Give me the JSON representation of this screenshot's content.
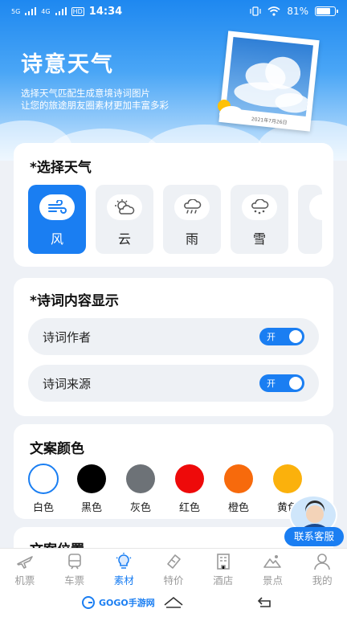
{
  "status_bar": {
    "signal_left": "5G",
    "signal_right": "4G",
    "network": "HD",
    "time": "14:34",
    "battery": "81%",
    "battery_level": 0.81
  },
  "hero": {
    "title": "诗意天气",
    "subtitle_line1": "选择天气匹配生成意境诗词图片",
    "subtitle_line2": "让您的旅途朋友圈素材更加丰富多彩",
    "photo_date": "2021年7月26日"
  },
  "weather_section": {
    "title": "*选择天气",
    "items": [
      {
        "label": "风",
        "icon": "wind-icon",
        "active": true
      },
      {
        "label": "云",
        "icon": "partly-cloudy-icon",
        "active": false
      },
      {
        "label": "雨",
        "icon": "rain-icon",
        "active": false
      },
      {
        "label": "雪",
        "icon": "snow-icon",
        "active": false
      }
    ]
  },
  "poem_section": {
    "title": "*诗词内容显示",
    "rows": [
      {
        "label": "诗词作者",
        "toggle": "开",
        "on": true
      },
      {
        "label": "诗词来源",
        "toggle": "开",
        "on": true
      }
    ]
  },
  "color_section": {
    "title": "文案颜色",
    "swatches": [
      {
        "label": "白色",
        "color": "#ffffff",
        "selected": true
      },
      {
        "label": "黑色",
        "color": "#000000",
        "selected": false
      },
      {
        "label": "灰色",
        "color": "#6d7277",
        "selected": false
      },
      {
        "label": "红色",
        "color": "#ee0a0a",
        "selected": false
      },
      {
        "label": "橙色",
        "color": "#f76a0c",
        "selected": false
      },
      {
        "label": "黄色",
        "color": "#fbb10c",
        "selected": false
      }
    ]
  },
  "position_section": {
    "title": "文案位置"
  },
  "customer_service": {
    "label": "联系客服"
  },
  "tabbar": {
    "tabs": [
      {
        "label": "机票",
        "icon": "plane-icon",
        "active": false
      },
      {
        "label": "车票",
        "icon": "train-icon",
        "active": false
      },
      {
        "label": "素材",
        "icon": "bulb-icon",
        "active": true
      },
      {
        "label": "特价",
        "icon": "ticket-icon",
        "active": false
      },
      {
        "label": "酒店",
        "icon": "hotel-icon",
        "active": false
      },
      {
        "label": "景点",
        "icon": "mountain-icon",
        "active": false
      },
      {
        "label": "我的",
        "icon": "person-icon",
        "active": false
      }
    ]
  },
  "watermark": "GOGO手游网",
  "colors": {
    "accent": "#1a7ef2",
    "inactive": "#9a9a9a"
  }
}
